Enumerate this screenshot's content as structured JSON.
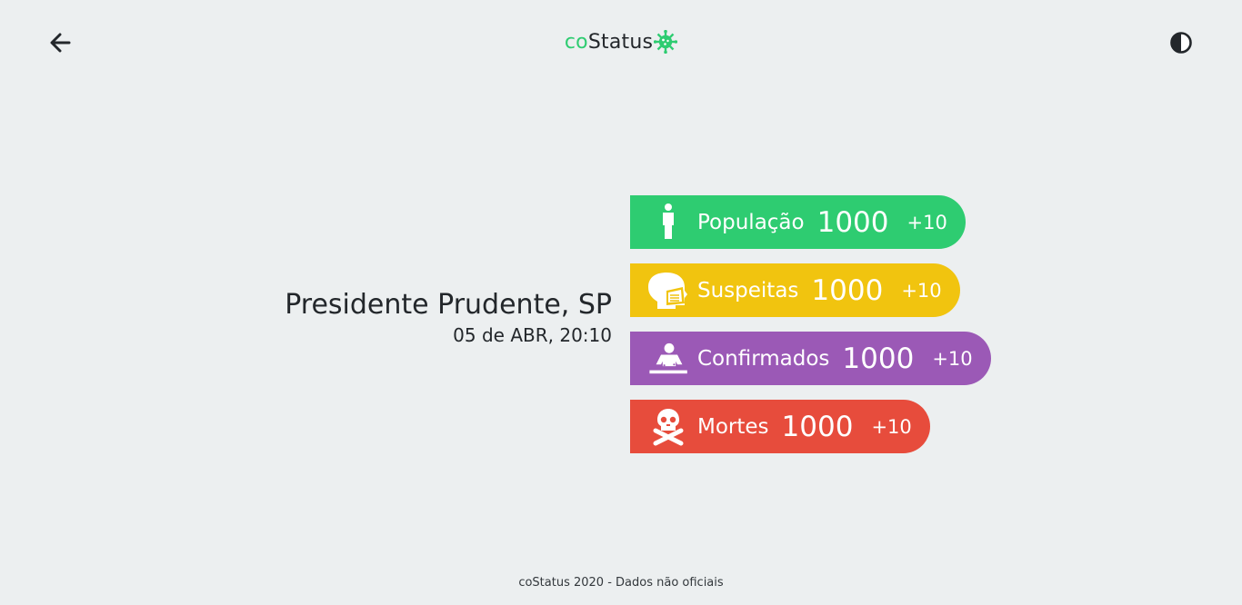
{
  "header": {
    "logo_prefix": "co",
    "logo_main": "Status",
    "back_icon": "arrow-left-icon",
    "theme_icon": "contrast-icon",
    "logo_icon": "virus-icon"
  },
  "location": {
    "city": "Presidente Prudente, SP",
    "date": "05 de ABR, 20:10"
  },
  "stats": [
    {
      "label": "População",
      "value": "1000",
      "delta": "+10",
      "icon": "person-icon",
      "color": "#2ecc71"
    },
    {
      "label": "Suspeitas",
      "value": "1000",
      "delta": "+10",
      "icon": "masked-head-icon",
      "color": "#f1c40f"
    },
    {
      "label": "Confirmados",
      "value": "1000",
      "delta": "+10",
      "icon": "patient-bed-icon",
      "color": "#9b59b6"
    },
    {
      "label": "Mortes",
      "value": "1000",
      "delta": "+10",
      "icon": "skull-crossbones-icon",
      "color": "#e74c3c"
    }
  ],
  "footer": {
    "text": "coStatus 2020 - Dados não oficiais"
  }
}
